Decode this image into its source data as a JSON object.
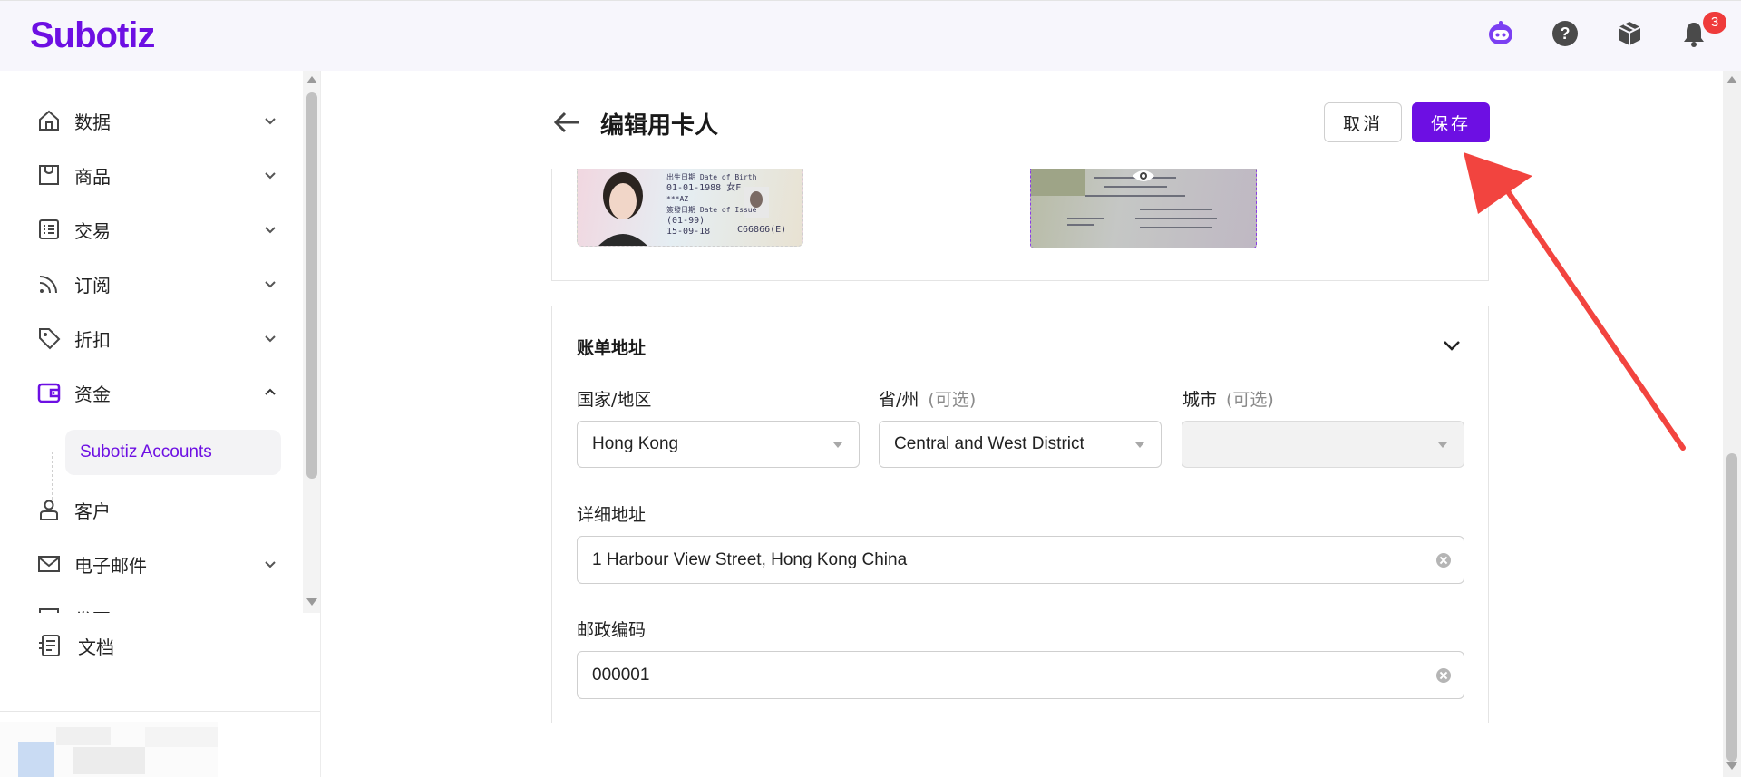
{
  "app": {
    "logo": "Subotiz",
    "notification_count": "3"
  },
  "header_icons": [
    "bot-icon",
    "help-icon",
    "package-icon",
    "bell-icon"
  ],
  "sidebar": {
    "items": [
      {
        "label": "数据",
        "icon": "home-icon",
        "expandable": true
      },
      {
        "label": "商品",
        "icon": "store-icon",
        "expandable": true
      },
      {
        "label": "交易",
        "icon": "list-icon",
        "expandable": true
      },
      {
        "label": "订阅",
        "icon": "rss-icon",
        "expandable": true
      },
      {
        "label": "折扣",
        "icon": "tag-icon",
        "expandable": true
      },
      {
        "label": "资金",
        "icon": "wallet-icon",
        "expandable": true,
        "expanded": true
      },
      {
        "label": "客户",
        "icon": "user-icon",
        "expandable": false
      },
      {
        "label": "电子邮件",
        "icon": "mail-icon",
        "expandable": true
      },
      {
        "label": "发票",
        "icon": "invoice-icon",
        "expandable": true
      }
    ],
    "sub_item": "Subotiz Accounts",
    "docs_label": "文档"
  },
  "page": {
    "title": "编辑用卡人",
    "cancel_label": "取消",
    "save_label": "保存"
  },
  "billing": {
    "section_title": "账单地址",
    "country_label": "国家/地区",
    "country_value": "Hong Kong",
    "province_label": "省/州",
    "province_optional": "(可选)",
    "province_value": "Central and West District",
    "city_label": "城市",
    "city_optional": "(可选)",
    "city_value": "",
    "address_label": "详细地址",
    "address_value": "1 Harbour View Street, Hong Kong China",
    "postal_label": "邮政编码",
    "postal_value": "000001"
  },
  "id_card": {
    "front_lines": [
      "出生日期 Date of Birth",
      "01-01-1988  女F",
      "***AZ",
      "簽發日期 Date of Issue",
      "(01-99)",
      "15-09-18",
      "C66866(E)"
    ]
  },
  "colors": {
    "brand": "#6d0fe3",
    "badge": "#ef3b3b",
    "annotation": "#f2443f"
  }
}
